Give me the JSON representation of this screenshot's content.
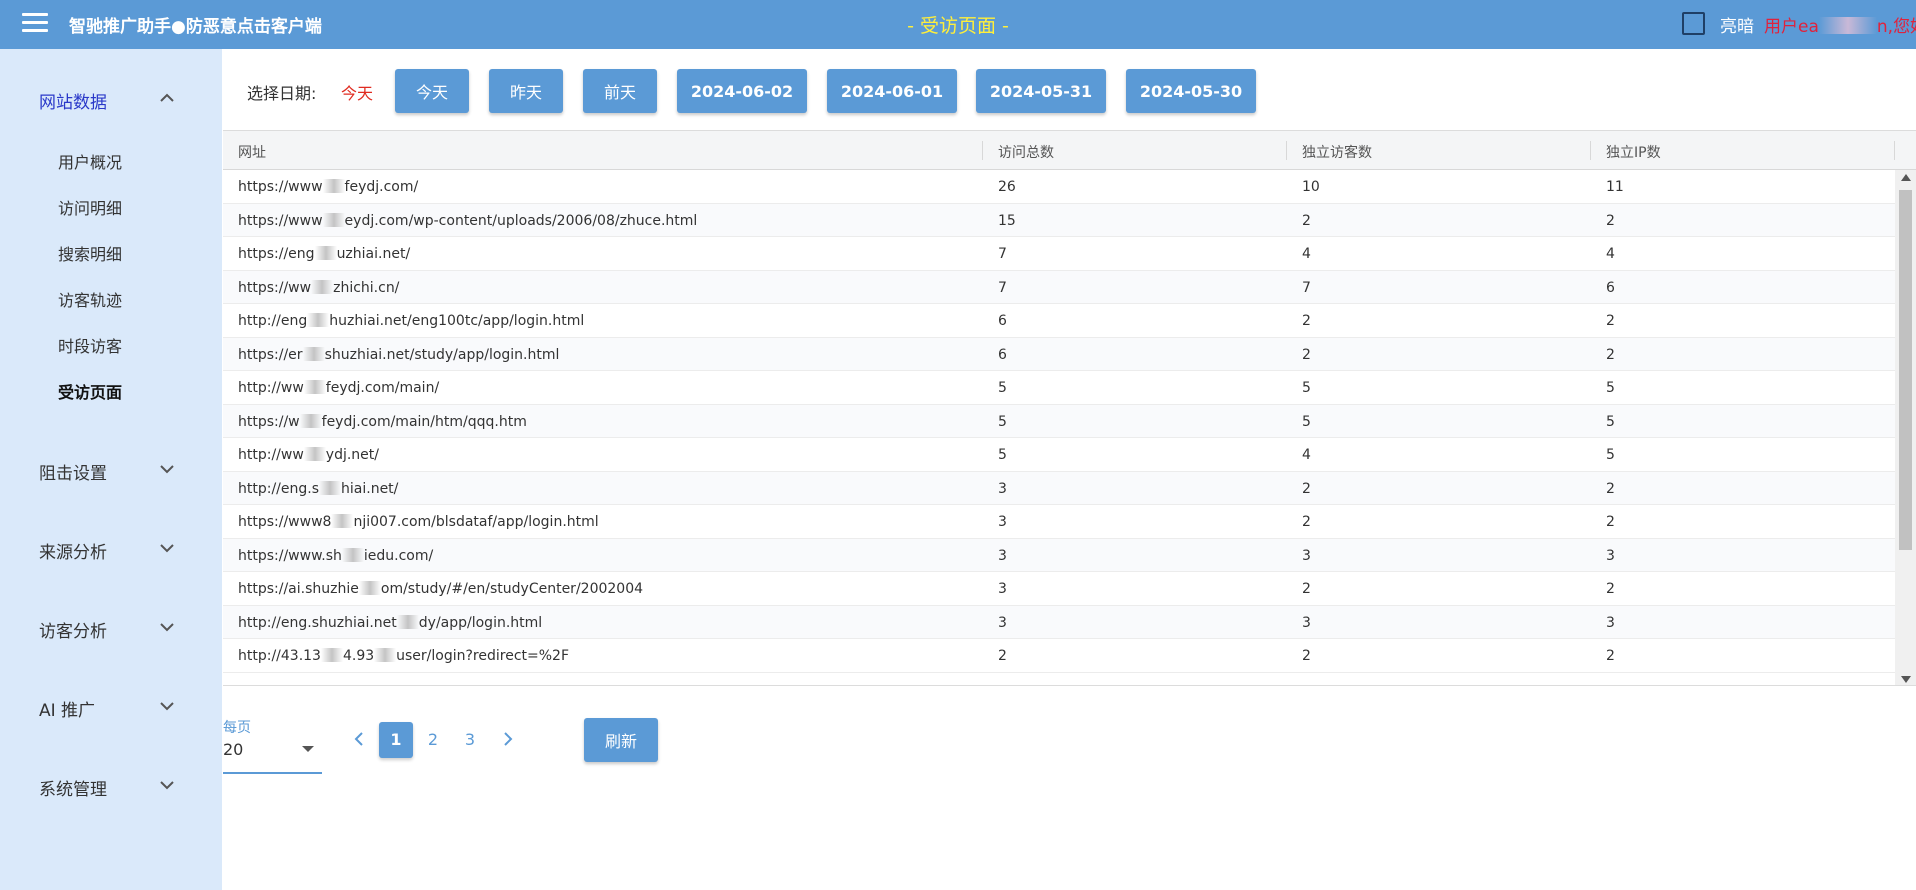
{
  "header": {
    "app_title": "智驰推广助手●防恶意点击客户端",
    "page_title": "- 受访页面 -",
    "theme_label": "亮暗",
    "user_prefix": "用户ea",
    "user_suffix": "n,您好"
  },
  "sidebar": {
    "groups": [
      {
        "label": "网站数据",
        "expanded": true
      },
      {
        "label": "阻击设置",
        "expanded": false
      },
      {
        "label": "来源分析",
        "expanded": false
      },
      {
        "label": "访客分析",
        "expanded": false
      },
      {
        "label": "AI 推广",
        "expanded": false
      },
      {
        "label": "系统管理",
        "expanded": false
      }
    ],
    "sub_items": [
      {
        "label": "用户概况"
      },
      {
        "label": "访问明细"
      },
      {
        "label": "搜索明细"
      },
      {
        "label": "访客轨迹"
      },
      {
        "label": "时段访客"
      },
      {
        "label": "受访页面",
        "current": true
      }
    ]
  },
  "date_filter": {
    "label": "选择日期:",
    "current": "今天",
    "buttons": [
      "今天",
      "昨天",
      "前天",
      "2024-06-02",
      "2024-06-01",
      "2024-05-31",
      "2024-05-30"
    ]
  },
  "table": {
    "columns": [
      "网址",
      "访问总数",
      "独立访客数",
      "独立IP数"
    ],
    "rows": [
      {
        "url_a": "https://www",
        "url_b": "feydj.com/",
        "total": "26",
        "visitors": "10",
        "ips": "11"
      },
      {
        "url_a": "https://www",
        "url_b": "eydj.com/wp-content/uploads/2006/08/zhuce.html",
        "total": "15",
        "visitors": "2",
        "ips": "2"
      },
      {
        "url_a": "https://eng",
        "url_b": "uzhiai.net/",
        "total": "7",
        "visitors": "4",
        "ips": "4"
      },
      {
        "url_a": "https://ww",
        "url_b": "zhichi.cn/",
        "total": "7",
        "visitors": "7",
        "ips": "6"
      },
      {
        "url_a": "http://eng",
        "url_b": "huzhiai.net/eng100tc/app/login.html",
        "total": "6",
        "visitors": "2",
        "ips": "2"
      },
      {
        "url_a": "https://er",
        "url_b": "shuzhiai.net/study/app/login.html",
        "total": "6",
        "visitors": "2",
        "ips": "2"
      },
      {
        "url_a": "http://ww",
        "url_b": "feydj.com/main/",
        "total": "5",
        "visitors": "5",
        "ips": "5"
      },
      {
        "url_a": "https://w",
        "url_b": "feydj.com/main/htm/qqq.htm",
        "total": "5",
        "visitors": "5",
        "ips": "5"
      },
      {
        "url_a": "http://ww",
        "url_b": "ydj.net/",
        "total": "5",
        "visitors": "4",
        "ips": "5"
      },
      {
        "url_a": "http://eng.s",
        "url_b": "hiai.net/",
        "total": "3",
        "visitors": "2",
        "ips": "2"
      },
      {
        "url_a": "https://www8",
        "url_b": "nji007.com/blsdataf/app/login.html",
        "total": "3",
        "visitors": "2",
        "ips": "2"
      },
      {
        "url_a": "https://www.sh",
        "url_b": "iedu.com/",
        "total": "3",
        "visitors": "3",
        "ips": "3"
      },
      {
        "url_a": "https://ai.shuzhie",
        "url_b": "om/study/#/en/studyCenter/2002004",
        "total": "3",
        "visitors": "2",
        "ips": "2"
      },
      {
        "url_a": "http://eng.shuzhiai.net",
        "url_b": "dy/app/login.html",
        "total": "3",
        "visitors": "3",
        "ips": "3"
      },
      {
        "url_a": "http://43.13",
        "url_b": "4.93",
        "url_c": "user/login?redirect=%2F",
        "total": "2",
        "visitors": "2",
        "ips": "2"
      }
    ]
  },
  "pagination": {
    "per_page_label": "每页",
    "per_page_value": "20",
    "pages": [
      "1",
      "2",
      "3"
    ],
    "current_page": "1",
    "refresh_label": "刷新"
  },
  "colors": {
    "accent": "#5b9ad6",
    "title_yellow": "#ffef3a",
    "user_red": "#e0223c",
    "today_red": "#e02b20",
    "sidebar_bg": "#dae9fa",
    "active_nav": "#2a39c9"
  },
  "icons": {
    "menu": "hamburger-icon",
    "expand": "chevron-down-icon",
    "collapse": "chevron-up-icon",
    "prev": "chevron-left-icon",
    "next": "chevron-right-icon",
    "dropdown": "caret-down-icon"
  }
}
